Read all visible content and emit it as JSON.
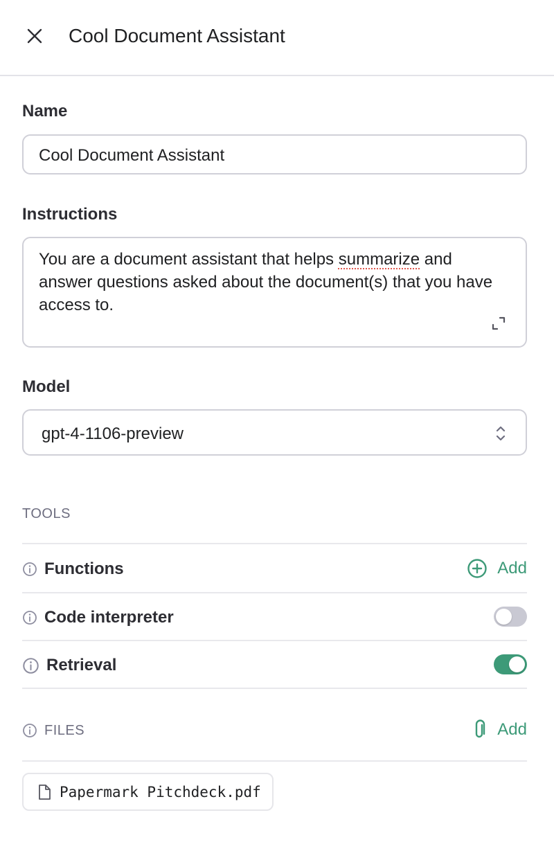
{
  "header": {
    "title": "Cool Document Assistant",
    "close_icon": "close-icon"
  },
  "name": {
    "label": "Name",
    "value": "Cool Document Assistant"
  },
  "instructions": {
    "label": "Instructions",
    "text_before": "You are a document assistant that helps ",
    "misspelled_word": "summarize",
    "text_after": " and answer questions asked about the document(s) that you have access to.",
    "expand_icon": "expand-icon"
  },
  "model": {
    "label": "Model",
    "selected": "gpt-4-1106-preview",
    "chevron_icon": "chevron-up-down-icon"
  },
  "tools": {
    "section_title": "TOOLS",
    "functions": {
      "label": "Functions",
      "add_label": "Add"
    },
    "code_interpreter": {
      "label": "Code interpreter",
      "enabled": false
    },
    "retrieval": {
      "label": "Retrieval",
      "enabled": true
    }
  },
  "files": {
    "section_title": "FILES",
    "add_label": "Add",
    "items": [
      {
        "name": "Papermark Pitchdeck.pdf"
      }
    ]
  },
  "colors": {
    "accent": "#3d9a78",
    "toggle_off": "#c9c9d3",
    "border": "#d0d0d8",
    "muted_text": "#6e6e80"
  }
}
